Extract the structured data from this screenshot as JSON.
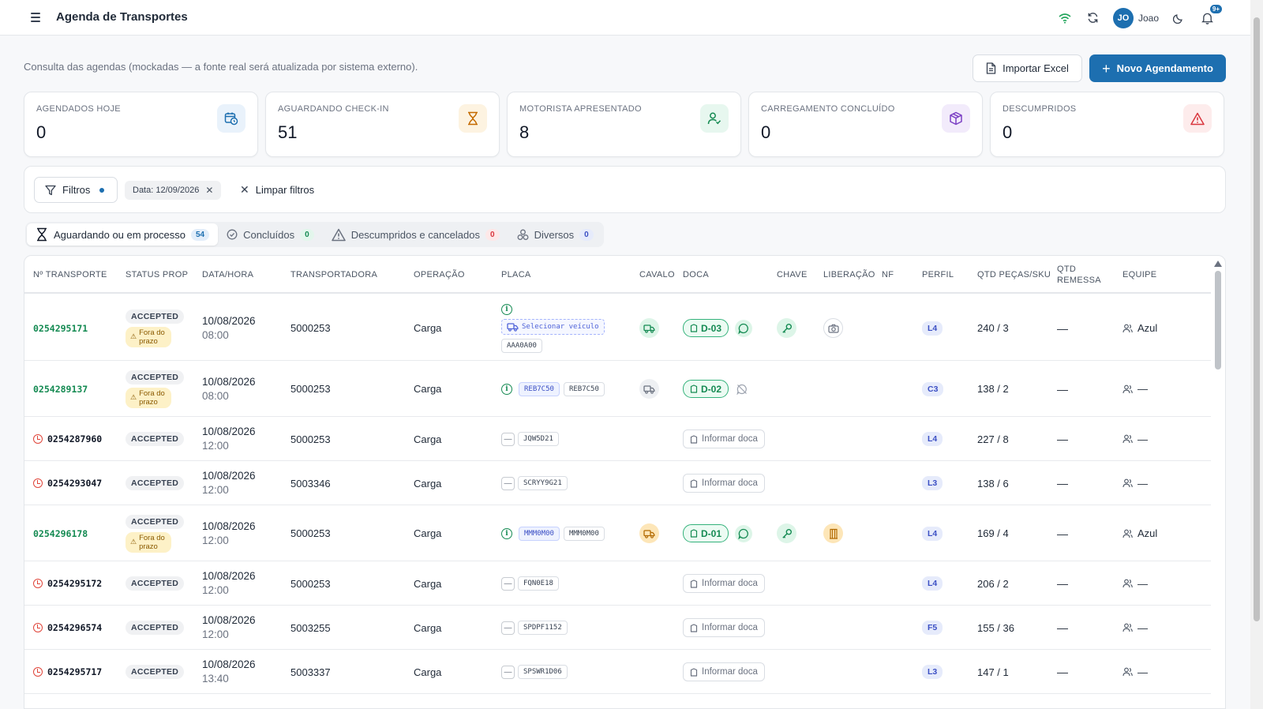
{
  "header": {
    "title": "Agenda de Transportes",
    "user_initials": "JO",
    "user_name": "Joao",
    "notifications": "9+"
  },
  "intro": {
    "subtitle": "Consulta das agendas (mockadas — a fonte real será atualizada por sistema externo).",
    "import_label": "Importar Excel",
    "new_label": "Novo Agendamento"
  },
  "cards": [
    {
      "label": "AGENDADOS HOJE",
      "value": "0",
      "icon": "calendar-clock-icon",
      "bg": "#e9f2fb",
      "color": "#1d6fb0"
    },
    {
      "label": "AGUARDANDO CHECK-IN",
      "value": "51",
      "icon": "hourglass-icon",
      "bg": "#fdf3e1",
      "color": "#c46a00"
    },
    {
      "label": "MOTORISTA APRESENTADO",
      "value": "8",
      "icon": "user-check-icon",
      "bg": "#e7f7ef",
      "color": "#148a52"
    },
    {
      "label": "CARREGAMENTO CONCLUÍDO",
      "value": "0",
      "icon": "package-icon",
      "bg": "#f2ebfb",
      "color": "#7b3fc4"
    },
    {
      "label": "DESCUMPRIDOS",
      "value": "0",
      "icon": "alert-triangle-icon",
      "bg": "#fdecec",
      "color": "#d9363e"
    }
  ],
  "filters": {
    "filtros_label": "Filtros",
    "date_chip": "Data: 12/09/2026",
    "clear_label": "Limpar filtros"
  },
  "tabs": [
    {
      "label": "Aguardando ou em processo",
      "count": "54",
      "icon": "hourglass-icon",
      "cbg": "#e3eefa",
      "cfg": "#1d6fb0"
    },
    {
      "label": "Concluídos",
      "count": "0",
      "icon": "check-circle-icon",
      "cbg": "#e3f6ec",
      "cfg": "#148a52"
    },
    {
      "label": "Descumpridos e cancelados",
      "count": "0",
      "icon": "alert-triangle-icon",
      "cbg": "#fde8e8",
      "cfg": "#d9363e"
    },
    {
      "label": "Diversos",
      "count": "0",
      "icon": "boxes-icon",
      "cbg": "#e6ebfb",
      "cfg": "#3b4fc4"
    }
  ],
  "columns": [
    "Nº TRANSPORTE",
    "STATUS PROP",
    "DATA/HORA",
    "TRANSPORTADORA",
    "OPERAÇÃO",
    "PLACA",
    "CAVALO",
    "DOCA",
    "CHAVE",
    "LIBERAÇÃO",
    "NF",
    "PERFIL",
    "QTD PEÇAS/SKU",
    "QTD REMESSA",
    "EQUIPE"
  ],
  "rows": [
    {
      "id": "0254295171",
      "state": "ok",
      "status": "ACCEPTED",
      "late": "Fora do prazo",
      "date": "10/08/2026",
      "time": "08:00",
      "carrier": "5000253",
      "op": "Carga",
      "plate_mode": "select",
      "plate_select": "Selecionar veículo",
      "plate1": "AAA0A00",
      "plate2": "",
      "cavalo": "green",
      "dock": "D-03",
      "dock_msg": "green",
      "chave": true,
      "lib": "camera",
      "perfil": "L4",
      "qtd": "240 / 3",
      "remessa": "—",
      "team": "Azul"
    },
    {
      "id": "0254289137",
      "state": "ok",
      "status": "ACCEPTED",
      "late": "Fora do prazo",
      "date": "10/08/2026",
      "time": "08:00",
      "carrier": "5000253",
      "op": "Carga",
      "plate_mode": "pair",
      "plate_select": "",
      "plate1": "REB7C50",
      "plate2": "REB7C50",
      "cavalo": "gray",
      "dock": "D-02",
      "dock_msg": "off",
      "chave": false,
      "lib": "",
      "perfil": "C3",
      "qtd": "138 / 2",
      "remessa": "—",
      "team": "—"
    },
    {
      "id": "0254287960",
      "state": "late",
      "status": "ACCEPTED",
      "late": "",
      "date": "10/08/2026",
      "time": "12:00",
      "carrier": "5000253",
      "op": "Carga",
      "plate_mode": "single",
      "plate_select": "",
      "plate1": "JQW5D21",
      "plate2": "",
      "cavalo": "",
      "dock": "",
      "dock_empty": "Informar doca",
      "dock_msg": "",
      "chave": false,
      "lib": "",
      "perfil": "L4",
      "qtd": "227 / 8",
      "remessa": "—",
      "team": "—"
    },
    {
      "id": "0254293047",
      "state": "late",
      "status": "ACCEPTED",
      "late": "",
      "date": "10/08/2026",
      "time": "12:00",
      "carrier": "5003346",
      "op": "Carga",
      "plate_mode": "single",
      "plate_select": "",
      "plate1": "SCRYY9G21",
      "plate2": "",
      "cavalo": "",
      "dock": "",
      "dock_empty": "Informar doca",
      "dock_msg": "",
      "chave": false,
      "lib": "",
      "perfil": "L3",
      "qtd": "138 / 6",
      "remessa": "—",
      "team": "—"
    },
    {
      "id": "0254296178",
      "state": "ok",
      "status": "ACCEPTED",
      "late": "Fora do prazo",
      "date": "10/08/2026",
      "time": "12:00",
      "carrier": "5000253",
      "op": "Carga",
      "plate_mode": "pair",
      "plate_select": "",
      "plate1": "MMM0M00",
      "plate2": "MMM0M00",
      "cavalo": "orange",
      "dock": "D-01",
      "dock_msg": "green",
      "chave": true,
      "lib": "door",
      "perfil": "L4",
      "qtd": "169 / 4",
      "remessa": "—",
      "team": "Azul"
    },
    {
      "id": "0254295172",
      "state": "late",
      "status": "ACCEPTED",
      "late": "",
      "date": "10/08/2026",
      "time": "12:00",
      "carrier": "5000253",
      "op": "Carga",
      "plate_mode": "single",
      "plate_select": "",
      "plate1": "FQN0E18",
      "plate2": "",
      "cavalo": "",
      "dock": "",
      "dock_empty": "Informar doca",
      "dock_msg": "",
      "chave": false,
      "lib": "",
      "perfil": "L4",
      "qtd": "206 / 2",
      "remessa": "—",
      "team": "—"
    },
    {
      "id": "0254296574",
      "state": "late",
      "status": "ACCEPTED",
      "late": "",
      "date": "10/08/2026",
      "time": "12:00",
      "carrier": "5003255",
      "op": "Carga",
      "plate_mode": "single",
      "plate_select": "",
      "plate1": "SPDPF1152",
      "plate2": "",
      "cavalo": "",
      "dock": "",
      "dock_empty": "Informar doca",
      "dock_msg": "",
      "chave": false,
      "lib": "",
      "perfil": "F5",
      "qtd": "155 / 36",
      "remessa": "—",
      "team": "—"
    },
    {
      "id": "0254295717",
      "state": "late",
      "status": "ACCEPTED",
      "late": "",
      "date": "10/08/2026",
      "time": "13:40",
      "carrier": "5003337",
      "op": "Carga",
      "plate_mode": "single",
      "plate_select": "",
      "plate1": "SPSWR1D06",
      "plate2": "",
      "cavalo": "",
      "dock": "",
      "dock_empty": "Informar doca",
      "dock_msg": "",
      "chave": false,
      "lib": "",
      "perfil": "L3",
      "qtd": "147 / 1",
      "remessa": "—",
      "team": "—"
    }
  ],
  "perfil_colors": {
    "L4": "#e6ebfb",
    "C3": "#e6ebfb",
    "L3": "#e6ebfb",
    "F5": "#e6ebfb"
  },
  "perfil_text": "#3b4fc4"
}
